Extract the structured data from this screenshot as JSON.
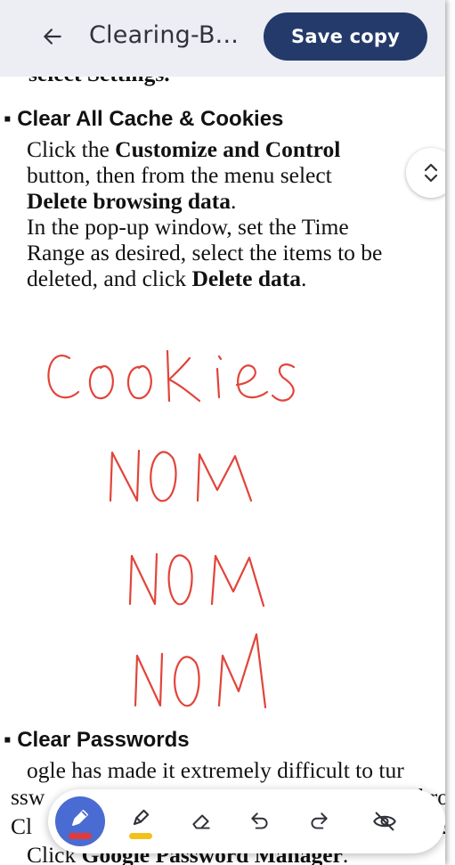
{
  "header": {
    "back_icon": "arrow-back-icon",
    "title": "Clearing-B...",
    "save_label": "Save copy"
  },
  "document": {
    "partial_top": "select Settings.",
    "section1": {
      "heading": "Clear All Cache & Cookies",
      "line1_pre": "Click the ",
      "line1_bold": "Customize and Control",
      "line2": "button, then from the menu select",
      "line3_bold": "Delete browsing data",
      "line3_post": ".",
      "line4": "In the pop-up window, set the Time",
      "line5": "Range as desired, select the items to be",
      "line6_pre": "deleted, and click ",
      "line6_bold": "Delete data",
      "line6_post": "."
    },
    "section2": {
      "heading": "Clear Passwords",
      "line1": "ogle has made it extremely difficult to tur",
      "line2_left": "ssw",
      "line2_right": "hro",
      "line3_left": "Cl",
      "line3_right": "s &",
      "line4_pre": "Click ",
      "line4_bold": "Google Password Manager",
      "line4_post": "."
    }
  },
  "handwriting": {
    "lines": [
      "Cookies",
      "NOM",
      "NOM",
      "NOM"
    ],
    "color": "#e2443a"
  },
  "toolbar": {
    "tools": [
      {
        "name": "pen",
        "icon": "pen-icon",
        "active": true,
        "swatch": "#e23a3a"
      },
      {
        "name": "highlighter",
        "icon": "highlighter-icon",
        "active": false,
        "swatch": "#f2c21b"
      },
      {
        "name": "eraser",
        "icon": "eraser-icon"
      },
      {
        "name": "undo",
        "icon": "undo-icon"
      },
      {
        "name": "redo",
        "icon": "redo-icon"
      },
      {
        "name": "hide-annotations",
        "icon": "visibility-off-icon"
      }
    ]
  },
  "colors": {
    "header_bg": "#edeef4",
    "save_button": "#243a6a",
    "active_tool": "#4a6bd1",
    "ink": "#e2443a"
  }
}
